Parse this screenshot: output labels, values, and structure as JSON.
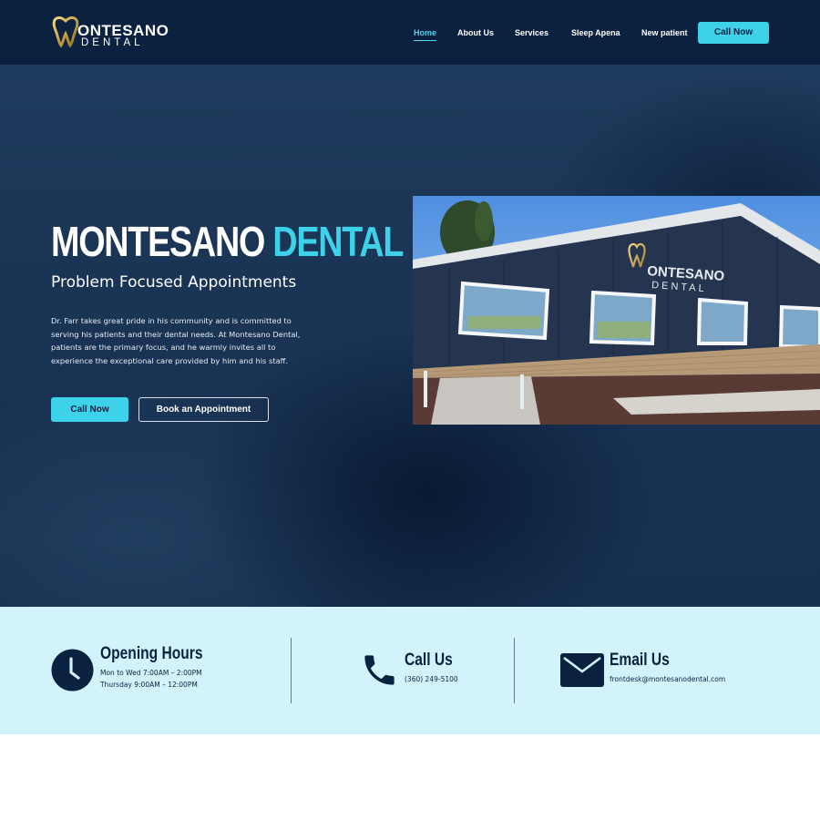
{
  "brand": {
    "logo_top": "ONTESANO",
    "logo_bottom": "DENTAL",
    "logo_mark": "M"
  },
  "nav": {
    "items": [
      {
        "label": "Home",
        "active": true
      },
      {
        "label": "About Us",
        "active": false
      },
      {
        "label": "Services",
        "active": false
      },
      {
        "label": "Sleep Apena",
        "active": false
      },
      {
        "label": "New patient",
        "active": false
      }
    ],
    "cta_label": "Call Now"
  },
  "hero": {
    "title_main": "MONTESANO",
    "title_accent": "DENTAL",
    "subtitle": "Problem Focused Appointments",
    "description": "Dr. Farr takes great pride in his community and is committed to serving his patients and their dental needs. At Montesano Dental, patients are the primary focus, and he warmly invites all to experience the exceptional care provided by him and his staff.",
    "primary_button": "Call Now",
    "secondary_button": "Book an Appointment",
    "photo_sign_top": "ONTESANO",
    "photo_sign_bottom": "DENTAL",
    "photo_sign_mark": "M"
  },
  "info": {
    "hours": {
      "title": "Opening Hours",
      "lines": [
        "Mon to Wed 7:00AM – 2:00PM",
        "Thursday 9:00AM – 12:00PM"
      ],
      "icon": "clock-icon"
    },
    "call": {
      "title": "Call Us",
      "value": "(360) 249-5100",
      "icon": "phone-icon"
    },
    "email": {
      "title": "Email Us",
      "value": "frontdesk@montesanodental.com",
      "icon": "envelope-icon"
    }
  },
  "colors": {
    "navy": "#0b2140",
    "accent": "#3dd1ea",
    "info_bg": "#d2f3fc",
    "gold": "#c9a24a"
  }
}
